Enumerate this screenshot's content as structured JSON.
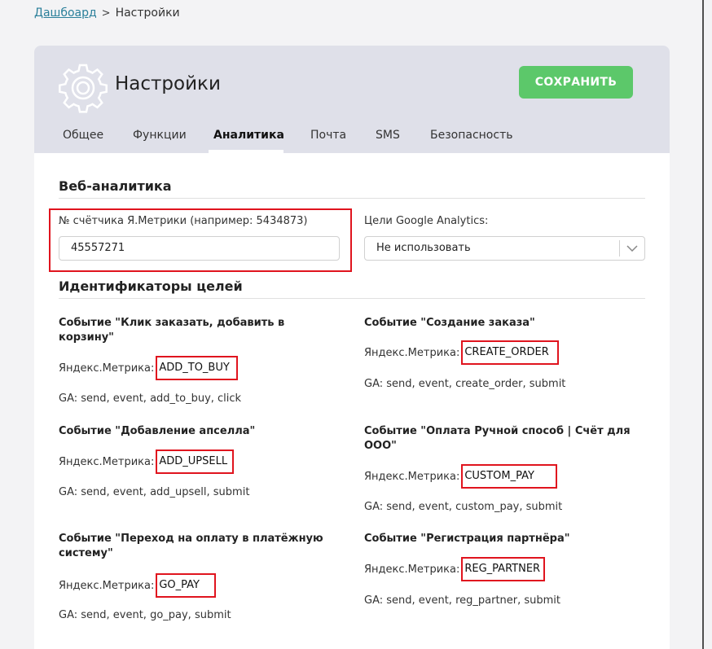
{
  "breadcrumb": {
    "home": "Дашбоард",
    "current": "Настройки"
  },
  "header": {
    "title": "Настройки",
    "save_label": "СОХРАНИТЬ"
  },
  "tabs": [
    {
      "label": "Общее"
    },
    {
      "label": "Функции"
    },
    {
      "label": "Аналитика"
    },
    {
      "label": "Почта"
    },
    {
      "label": "SMS"
    },
    {
      "label": "Безопасность"
    }
  ],
  "web_analytics": {
    "title": "Веб-аналитика",
    "ym_label": "№ счётчика Я.Метрики (например: 5434873)",
    "ym_value": "45557271",
    "ga_label": "Цели Google Analytics:",
    "ga_value": "Не использовать"
  },
  "goals": {
    "title": "Идентификаторы целей",
    "ym_prefix": "Яндекс.Метрика:",
    "events": [
      {
        "title": "Событие \"Клик заказать, добавить в корзину\"",
        "code": "ADD_TO_BUY",
        "ga": "GA: send, event, add_to_buy, click"
      },
      {
        "title": "Событие \"Создание заказа\"",
        "code": "CREATE_ORDER",
        "ga": "GA: send, event, create_order, submit"
      },
      {
        "title": "Событие \"Добавление апселла\"",
        "code": "ADD_UPSELL",
        "ga": "GA: send, event, add_upsell, submit"
      },
      {
        "title": "Событие \"Оплата Ручной способ | Счёт для ООО\"",
        "code": "CUSTOM_PAY",
        "ga": "GA: send, event, custom_pay, submit"
      },
      {
        "title": "Событие \"Переход на оплату в платёжную систему\"",
        "code": "GO_PAY",
        "ga": "GA: send, event, go_pay, submit"
      },
      {
        "title": "Событие \"Регистрация партнёра\"",
        "code": "REG_PARTNER",
        "ga": "GA: send, event, reg_partner, submit"
      }
    ]
  },
  "colors": {
    "accent_green": "#5cc86a",
    "highlight_red": "#e0141e",
    "header_bg": "#dfe0e9"
  }
}
